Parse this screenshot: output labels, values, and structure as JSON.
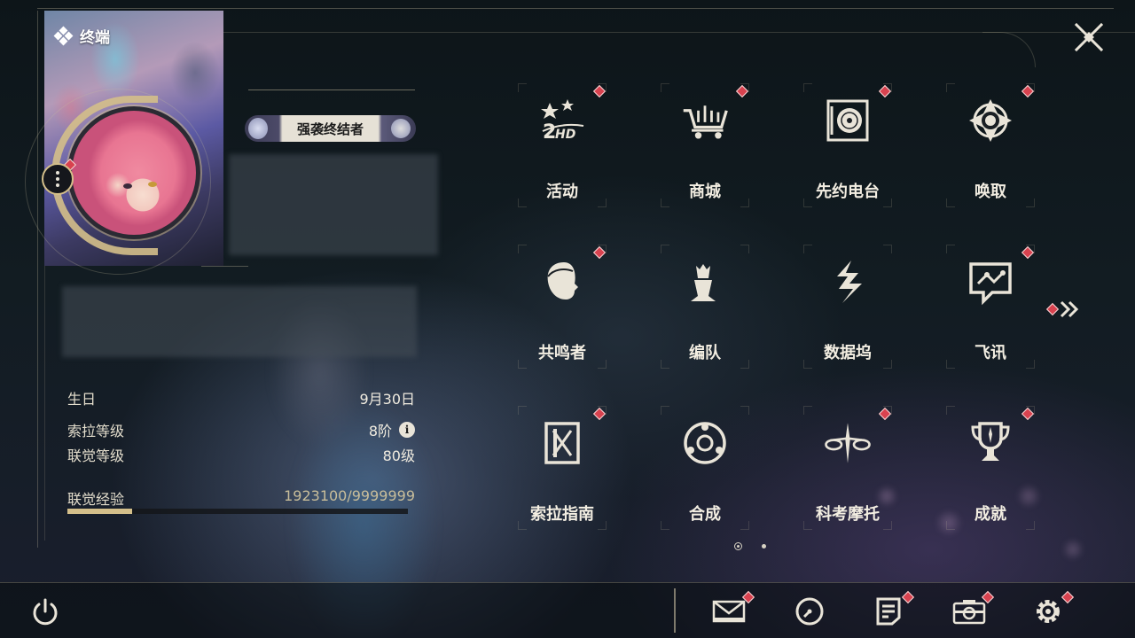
{
  "app": {
    "terminal_label": "终端"
  },
  "profile": {
    "title_badge": "强袭终结者",
    "stats": [
      {
        "label": "生日",
        "value": "9月30日"
      },
      {
        "label": "索拉等级",
        "value": "8阶"
      },
      {
        "label": "联觉等级",
        "value": "80级"
      }
    ],
    "exp": {
      "label": "联觉经验",
      "value": "1923100/9999999",
      "progress_fraction": 0.19
    }
  },
  "menu": {
    "items": [
      {
        "label": "活动",
        "icon": "event-2hd-icon",
        "badge": true
      },
      {
        "label": "商城",
        "icon": "shop-cart-icon",
        "badge": true
      },
      {
        "label": "先约电台",
        "icon": "radio-record-icon",
        "badge": true
      },
      {
        "label": "唤取",
        "icon": "summon-compass-icon",
        "badge": true
      },
      {
        "label": "共鸣者",
        "icon": "resonator-head-icon",
        "badge": true
      },
      {
        "label": "编队",
        "icon": "team-chess-icon",
        "badge": false
      },
      {
        "label": "数据坞",
        "icon": "data-dock-icon",
        "badge": false
      },
      {
        "label": "飞讯",
        "icon": "message-chat-icon",
        "badge": true
      },
      {
        "label": "索拉指南",
        "icon": "guide-book-icon",
        "badge": true
      },
      {
        "label": "合成",
        "icon": "synthesis-orb-icon",
        "badge": false
      },
      {
        "label": "科考摩托",
        "icon": "motorbike-icon",
        "badge": true
      },
      {
        "label": "成就",
        "icon": "trophy-icon",
        "badge": true
      }
    ],
    "page": {
      "current": 1,
      "total": 2
    }
  },
  "bottom_bar": {
    "buttons": [
      {
        "name": "mail",
        "icon": "mail-icon",
        "badge": true
      },
      {
        "name": "clock",
        "icon": "clock-icon",
        "badge": false
      },
      {
        "name": "notice",
        "icon": "notice-doc-icon",
        "badge": true
      },
      {
        "name": "camera",
        "icon": "camera-icon",
        "badge": true
      },
      {
        "name": "settings",
        "icon": "gear-icon",
        "badge": true
      }
    ]
  },
  "colors": {
    "accent_gold": "#d4bf8a",
    "badge_red": "#d8424f",
    "text": "#f3eee2"
  }
}
